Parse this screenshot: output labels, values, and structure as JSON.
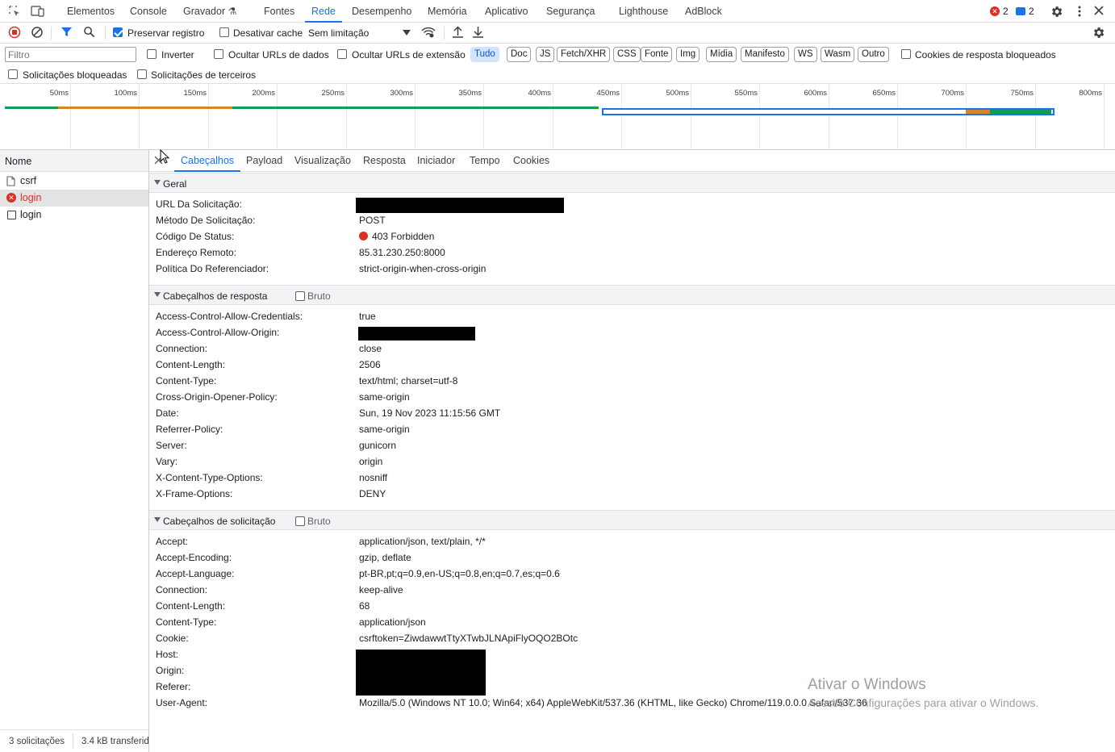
{
  "topbar": {
    "tabs": [
      "Elementos",
      "Console",
      "Gravador",
      "Fontes",
      "Rede",
      "Desempenho",
      "Memória",
      "Aplicativo",
      "Segurança",
      "Lighthouse",
      "AdBlock"
    ],
    "error_count": "2",
    "message_count": "2"
  },
  "toolbar": {
    "preserve_log": "Preservar registro",
    "disable_cache": "Desativar cache",
    "throttling": "Sem limitação"
  },
  "filter": {
    "placeholder": "Filtro",
    "invert": "Inverter",
    "hide_data_urls": "Ocultar URLs de dados",
    "hide_ext_urls": "Ocultar URLs de extensão",
    "types": [
      "Tudo",
      "Doc",
      "JS",
      "Fetch/XHR",
      "CSS",
      "Fonte",
      "Img",
      "Mídia",
      "Manifesto",
      "WS",
      "Wasm",
      "Outro"
    ],
    "blocked_cookies": "Cookies de resposta bloqueados",
    "blocked_requests": "Solicitações bloqueadas",
    "third_party": "Solicitações de terceiros"
  },
  "overview": {
    "ticks": [
      "50ms",
      "100ms",
      "150ms",
      "200ms",
      "250ms",
      "300ms",
      "350ms",
      "400ms",
      "450ms",
      "500ms",
      "550ms",
      "600ms",
      "650ms",
      "700ms",
      "750ms",
      "800ms"
    ],
    "colors": {
      "green": "#0f9d58",
      "orange": "#d4842b",
      "blue": "#1a73e8"
    }
  },
  "list": {
    "header": "Nome",
    "items": [
      {
        "name": "csrf",
        "status": "ok"
      },
      {
        "name": "login",
        "status": "error"
      },
      {
        "name": "login",
        "status": "ok"
      }
    ],
    "footer_requests": "3 solicitações",
    "footer_transfer": "3.4 kB transferid"
  },
  "details": {
    "tabs": [
      "Cabeçalhos",
      "Payload",
      "Visualização",
      "Resposta",
      "Iniciador",
      "Tempo",
      "Cookies"
    ],
    "general_title": "Geral",
    "general": [
      {
        "k": "URL Da Solicitação:",
        "v": ""
      },
      {
        "k": "Método De Solicitação:",
        "v": "POST"
      },
      {
        "k": "Código De Status:",
        "v": "403 Forbidden"
      },
      {
        "k": "Endereço Remoto:",
        "v": "85.31.230.250:8000"
      },
      {
        "k": "Política Do Referenciador:",
        "v": "strict-origin-when-cross-origin"
      }
    ],
    "response_title": "Cabeçalhos de resposta",
    "raw_label": "Bruto",
    "response": [
      {
        "k": "Access-Control-Allow-Credentials:",
        "v": "true"
      },
      {
        "k": "Access-Control-Allow-Origin:",
        "v": ""
      },
      {
        "k": "Connection:",
        "v": "close"
      },
      {
        "k": "Content-Length:",
        "v": "2506"
      },
      {
        "k": "Content-Type:",
        "v": "text/html; charset=utf-8"
      },
      {
        "k": "Cross-Origin-Opener-Policy:",
        "v": "same-origin"
      },
      {
        "k": "Date:",
        "v": "Sun, 19 Nov 2023 11:15:56 GMT"
      },
      {
        "k": "Referrer-Policy:",
        "v": "same-origin"
      },
      {
        "k": "Server:",
        "v": "gunicorn"
      },
      {
        "k": "Vary:",
        "v": "origin"
      },
      {
        "k": "X-Content-Type-Options:",
        "v": "nosniff"
      },
      {
        "k": "X-Frame-Options:",
        "v": "DENY"
      }
    ],
    "request_title": "Cabeçalhos de solicitação",
    "request": [
      {
        "k": "Accept:",
        "v": "application/json, text/plain, */*"
      },
      {
        "k": "Accept-Encoding:",
        "v": "gzip, deflate"
      },
      {
        "k": "Accept-Language:",
        "v": "pt-BR,pt;q=0.9,en-US;q=0.8,en;q=0.7,es;q=0.6"
      },
      {
        "k": "Connection:",
        "v": "keep-alive"
      },
      {
        "k": "Content-Length:",
        "v": "68"
      },
      {
        "k": "Content-Type:",
        "v": "application/json"
      },
      {
        "k": "Cookie:",
        "v": "csrftoken=ZiwdawwtTtyXTwbJLNApiFlyOQO2BOtc"
      },
      {
        "k": "Host:",
        "v": ""
      },
      {
        "k": "Origin:",
        "v": ""
      },
      {
        "k": "Referer:",
        "v": ""
      },
      {
        "k": "User-Agent:",
        "v": "Mozilla/5.0 (Windows NT 10.0; Win64; x64) AppleWebKit/537.36 (KHTML, like Gecko) Chrome/119.0.0.0 Safari/537.36"
      }
    ]
  },
  "watermark": {
    "title": "Ativar o Windows",
    "subtitle": "Acesse Configurações para ativar o Windows."
  }
}
